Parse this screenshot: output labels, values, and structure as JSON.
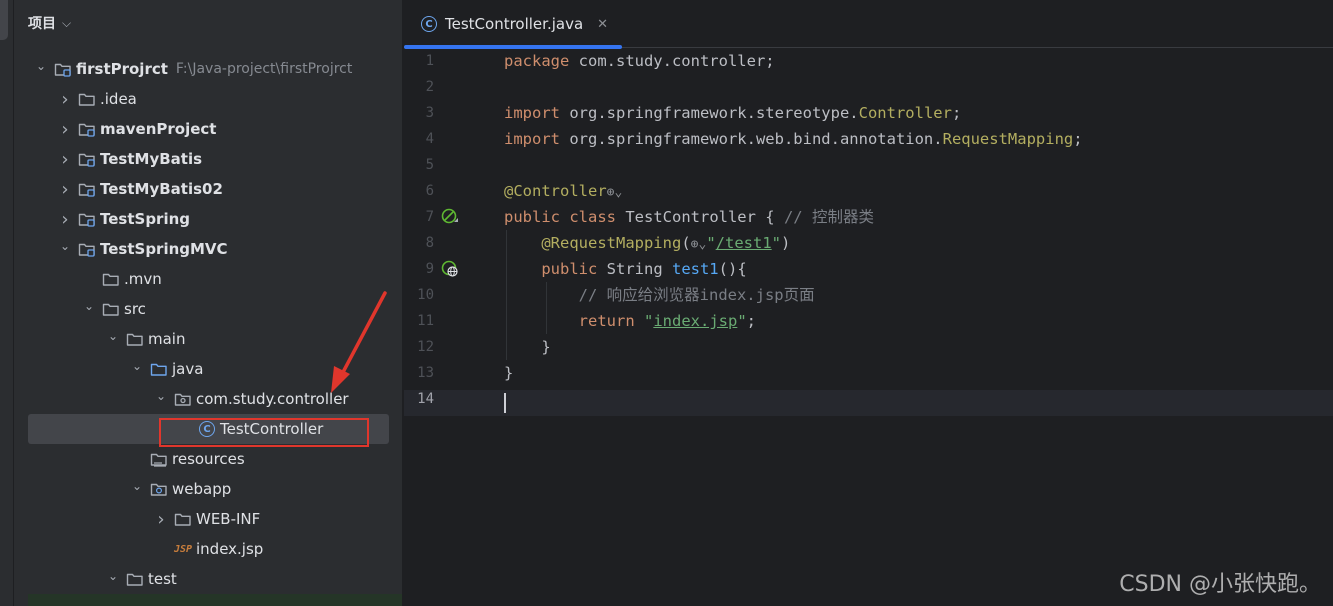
{
  "panel": {
    "title": "项目",
    "tree": [
      {
        "label": "firstProjrct",
        "hint": "F:\\Java-project\\firstProjrct",
        "indent": 0,
        "arrow": "down",
        "icon": "module-folder-icon",
        "bold": true
      },
      {
        "label": ".idea",
        "indent": 1,
        "arrow": "right",
        "icon": "folder-icon",
        "bold": false
      },
      {
        "label": "mavenProject",
        "indent": 1,
        "arrow": "right",
        "icon": "module-folder-icon",
        "bold": true
      },
      {
        "label": "TestMyBatis",
        "indent": 1,
        "arrow": "right",
        "icon": "module-folder-icon",
        "bold": true
      },
      {
        "label": "TestMyBatis02",
        "indent": 1,
        "arrow": "right",
        "icon": "module-folder-icon",
        "bold": true
      },
      {
        "label": "TestSpring",
        "indent": 1,
        "arrow": "right",
        "icon": "module-folder-icon",
        "bold": true
      },
      {
        "label": "TestSpringMVC",
        "indent": 1,
        "arrow": "down",
        "icon": "module-folder-icon",
        "bold": true
      },
      {
        "label": ".mvn",
        "indent": 2,
        "arrow": "none",
        "icon": "folder-icon",
        "bold": false
      },
      {
        "label": "src",
        "indent": 2,
        "arrow": "down",
        "icon": "folder-icon",
        "bold": false
      },
      {
        "label": "main",
        "indent": 3,
        "arrow": "down",
        "icon": "folder-icon",
        "bold": false
      },
      {
        "label": "java",
        "indent": 4,
        "arrow": "down",
        "icon": "source-folder-icon",
        "bold": false
      },
      {
        "label": "com.study.controller",
        "indent": 5,
        "arrow": "down",
        "icon": "package-icon",
        "bold": false
      },
      {
        "label": "TestController",
        "indent": 6,
        "arrow": "none",
        "icon": "java-class-icon",
        "bold": false,
        "selected": true
      },
      {
        "label": "resources",
        "indent": 4,
        "arrow": "none",
        "icon": "resources-folder-icon",
        "bold": false
      },
      {
        "label": "webapp",
        "indent": 4,
        "arrow": "down",
        "icon": "web-folder-icon",
        "bold": false
      },
      {
        "label": "WEB-INF",
        "indent": 5,
        "arrow": "right",
        "icon": "folder-icon",
        "bold": false
      },
      {
        "label": "index.jsp",
        "indent": 5,
        "arrow": "none",
        "icon": "jsp-file-icon",
        "bold": false
      },
      {
        "label": "test",
        "indent": 3,
        "arrow": "down",
        "icon": "folder-icon",
        "bold": false
      }
    ]
  },
  "editor": {
    "tab": {
      "label": "TestController.java",
      "close": "✕"
    },
    "current_line": 14,
    "lines": [
      {
        "n": "1",
        "tokens": [
          {
            "t": "package ",
            "c": "kw"
          },
          {
            "t": "com.study.controller;",
            "c": "cls"
          }
        ]
      },
      {
        "n": "2",
        "tokens": []
      },
      {
        "n": "3",
        "tokens": [
          {
            "t": "import ",
            "c": "kw"
          },
          {
            "t": "org.springframework.stereotype.",
            "c": "cls"
          },
          {
            "t": "Controller",
            "c": "anncls"
          },
          {
            "t": ";",
            "c": "cls"
          }
        ]
      },
      {
        "n": "4",
        "tokens": [
          {
            "t": "import ",
            "c": "kw"
          },
          {
            "t": "org.springframework.web.bind.annotation.",
            "c": "cls"
          },
          {
            "t": "RequestMapping",
            "c": "anncls"
          },
          {
            "t": ";",
            "c": "cls"
          }
        ]
      },
      {
        "n": "5",
        "tokens": []
      },
      {
        "n": "6",
        "tokens": [
          {
            "t": "@Controller",
            "c": "ann"
          },
          {
            "t": "⊕⌄",
            "c": "inlay"
          }
        ]
      },
      {
        "n": "7",
        "tokens": [
          {
            "t": "public class ",
            "c": "kw"
          },
          {
            "t": "TestController { ",
            "c": "cls"
          },
          {
            "t": "// 控制器类",
            "c": "cmt"
          }
        ]
      },
      {
        "n": "8",
        "tokens": [
          {
            "t": "    ",
            "c": "cls"
          },
          {
            "t": "@RequestMapping",
            "c": "ann"
          },
          {
            "t": "(",
            "c": "cls"
          },
          {
            "t": "⊕⌄",
            "c": "inlay"
          },
          {
            "t": "\"",
            "c": "str"
          },
          {
            "t": "/test1",
            "c": "link"
          },
          {
            "t": "\"",
            "c": "str"
          },
          {
            "t": ")",
            "c": "cls"
          }
        ]
      },
      {
        "n": "9",
        "tokens": [
          {
            "t": "    ",
            "c": "cls"
          },
          {
            "t": "public ",
            "c": "kw"
          },
          {
            "t": "String ",
            "c": "cls"
          },
          {
            "t": "test1",
            "c": "fn"
          },
          {
            "t": "(){",
            "c": "cls"
          }
        ]
      },
      {
        "n": "10",
        "tokens": [
          {
            "t": "        ",
            "c": "cls"
          },
          {
            "t": "// 响应给浏览器index.jsp页面",
            "c": "cmt"
          }
        ]
      },
      {
        "n": "11",
        "tokens": [
          {
            "t": "        ",
            "c": "cls"
          },
          {
            "t": "return ",
            "c": "kw"
          },
          {
            "t": "\"",
            "c": "str"
          },
          {
            "t": "index.jsp",
            "c": "link"
          },
          {
            "t": "\"",
            "c": "str"
          },
          {
            "t": ";",
            "c": "cls"
          }
        ]
      },
      {
        "n": "12",
        "tokens": [
          {
            "t": "    }",
            "c": "cls"
          }
        ]
      },
      {
        "n": "13",
        "tokens": [
          {
            "t": "}",
            "c": "cls"
          }
        ]
      },
      {
        "n": "14",
        "tokens": []
      }
    ]
  },
  "colors": {
    "accent": "#3574f0",
    "highlight": "#e0362c"
  },
  "watermark": "CSDN @小张快跑。"
}
